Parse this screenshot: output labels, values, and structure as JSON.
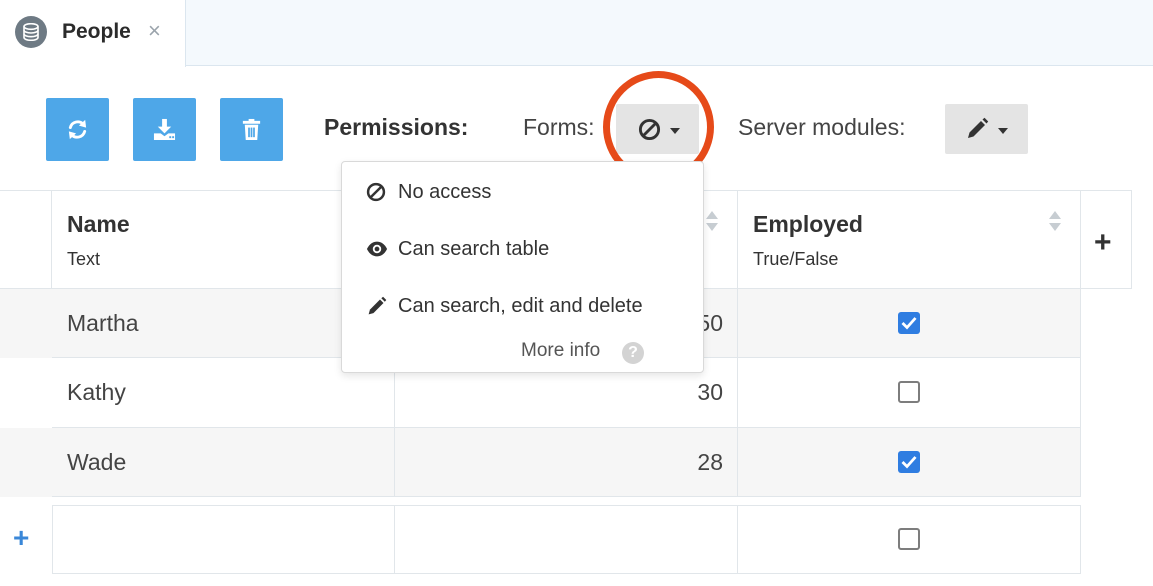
{
  "tab": {
    "title": "People",
    "close_glyph": "×",
    "icon": "database-icon"
  },
  "toolbar": {
    "buttons": [
      {
        "name": "refresh",
        "icon": "refresh-icon"
      },
      {
        "name": "download",
        "icon": "download-icon"
      },
      {
        "name": "delete",
        "icon": "trash-icon"
      }
    ],
    "accent": "#4ea7e8"
  },
  "permissions": {
    "label": "Permissions:",
    "forms_label": "Forms:",
    "forms_value_icon": "ban-icon",
    "server_modules_label": "Server modules:",
    "server_modules_value_icon": "pencil-icon",
    "highlight_color": "#e64a19"
  },
  "forms_menu": {
    "items": [
      {
        "icon": "ban-icon",
        "label": "No access"
      },
      {
        "icon": "eye-icon",
        "label": "Can search table"
      },
      {
        "icon": "pencil-icon",
        "label": "Can search, edit and delete"
      }
    ],
    "more_info": "More info",
    "help_glyph": "?"
  },
  "grid": {
    "columns": [
      {
        "title": "Name",
        "type": "Text"
      },
      {
        "title": "",
        "type": ""
      },
      {
        "title": "Employed",
        "type": "True/False"
      }
    ],
    "rows": [
      {
        "name": "Martha",
        "age": "50",
        "employed": true
      },
      {
        "name": "Kathy",
        "age": "30",
        "employed": false
      },
      {
        "name": "Wade",
        "age": "28",
        "employed": true
      }
    ],
    "new_row": {
      "name": "",
      "age": "",
      "employed": false
    },
    "add_column_glyph": "+",
    "add_row_glyph": "+",
    "checkbox_color": "#2f7de1"
  }
}
